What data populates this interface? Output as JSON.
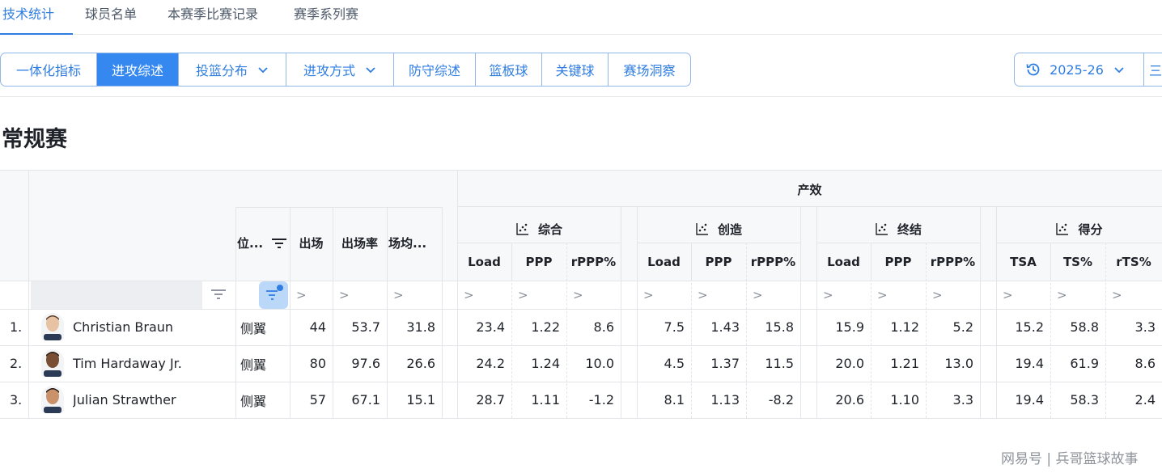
{
  "top_tabs": [
    "技术统计",
    "球员名单",
    "本赛季比赛记录",
    "赛季系列赛"
  ],
  "seg_buttons": [
    "一体化指标",
    "进攻综述",
    "投篮分布",
    "进攻方式",
    "防守综述",
    "篮板球",
    "关键球",
    "赛场洞察"
  ],
  "season": "2025-26",
  "extra": "三",
  "section_title": "常规赛",
  "table": {
    "group_title": "产效",
    "headers": {
      "position": "位...",
      "games": "出场",
      "games_rate": "出场率",
      "avg": "场均...",
      "groups": [
        "综合",
        "创造",
        "终结",
        "得分"
      ],
      "sub": [
        [
          "Load",
          "PPP",
          "rPPP%"
        ],
        [
          "Load",
          "PPP",
          "rPPP%"
        ],
        [
          "Load",
          "PPP",
          "rPPP%"
        ],
        [
          "TSA",
          "TS%",
          "rTS%"
        ]
      ]
    },
    "gt": ">",
    "rows": [
      {
        "rank": "1.",
        "name": "Christian Braun",
        "pos": "侧翼",
        "g": "44",
        "gr": "53.7",
        "avg": "31.8",
        "vals": [
          "23.4",
          "1.22",
          "8.6",
          "7.5",
          "1.43",
          "15.8",
          "15.9",
          "1.12",
          "5.2",
          "15.2",
          "58.8",
          "3.3"
        ]
      },
      {
        "rank": "2.",
        "name": "Tim Hardaway Jr.",
        "pos": "侧翼",
        "g": "80",
        "gr": "97.6",
        "avg": "26.6",
        "vals": [
          "24.2",
          "1.24",
          "10.0",
          "4.5",
          "1.37",
          "11.5",
          "20.0",
          "1.21",
          "13.0",
          "19.4",
          "61.9",
          "8.6"
        ]
      },
      {
        "rank": "3.",
        "name": "Julian Strawther",
        "pos": "侧翼",
        "g": "57",
        "gr": "67.1",
        "avg": "15.1",
        "vals": [
          "28.7",
          "1.11",
          "-1.2",
          "8.1",
          "1.13",
          "-8.2",
          "20.6",
          "1.10",
          "3.3",
          "19.4",
          "58.3",
          "2.4"
        ]
      }
    ]
  },
  "watermark": "网易号 | 兵哥篮球故事",
  "colors": {
    "accent": "#2f7de1",
    "active_bg": "#3588f0",
    "border": "#91b7e8"
  }
}
